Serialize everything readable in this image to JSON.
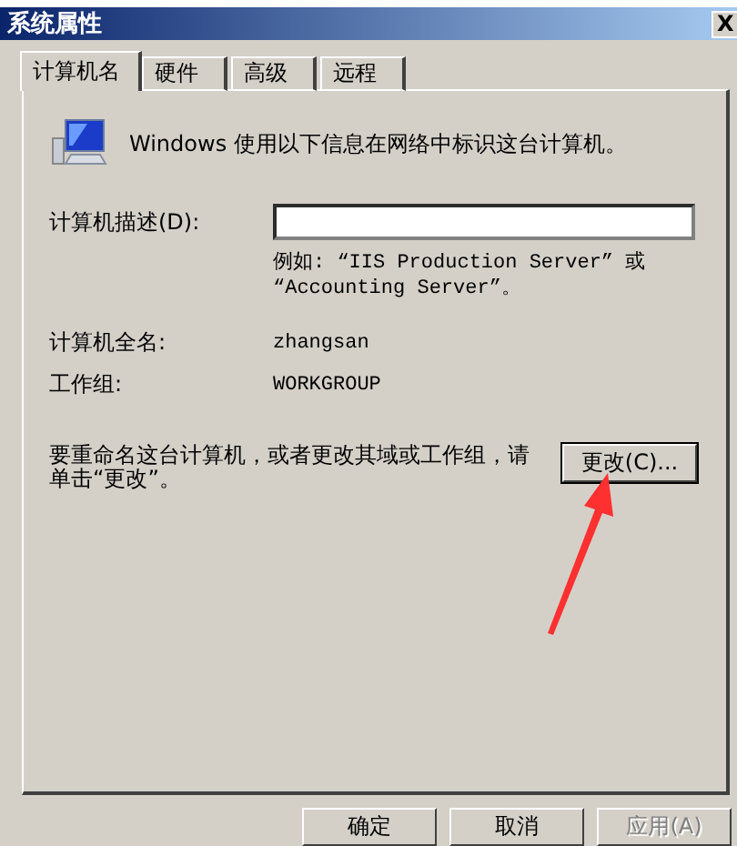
{
  "window": {
    "title": "系统属性",
    "close": "X"
  },
  "tabs": [
    {
      "label": "计算机名",
      "selected": true
    },
    {
      "label": "硬件",
      "selected": false
    },
    {
      "label": "高级",
      "selected": false
    },
    {
      "label": "远程",
      "selected": false
    }
  ],
  "intro": "Windows 使用以下信息在网络中标识这台计算机。",
  "description": {
    "label": "计算机描述(D):",
    "hint": "例如: “IIS Production Server” 或 “Accounting Server”。"
  },
  "full_name": {
    "label": "计算机全名:",
    "value": "zhangsan"
  },
  "workgroup": {
    "label": "工作组:",
    "value": "WORKGROUP"
  },
  "rename": {
    "text": "要重命名这台计算机，或者更改其域或工作组，请单击“更改”。",
    "button": "更改(C)..."
  },
  "buttons": [
    {
      "label": "确定",
      "disabled": false
    },
    {
      "label": "取消",
      "disabled": false
    },
    {
      "label": "应用(A)",
      "disabled": true
    }
  ]
}
